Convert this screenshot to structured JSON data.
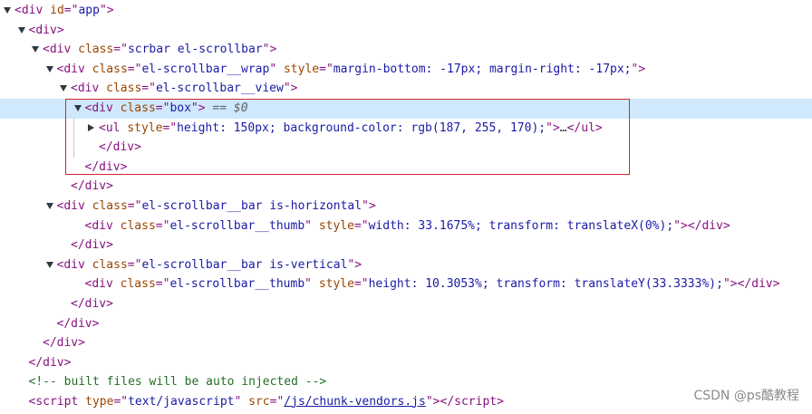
{
  "colors": {
    "tag": "#881280",
    "attr_name": "#994500",
    "attr_value": "#1a1aa6",
    "comment": "#236e25",
    "selected_row": "#cfe8fc",
    "highlight_box": "#d6232f"
  },
  "selection_marker": "== $0",
  "ellipsis": "…",
  "rows": [
    {
      "depth": 0,
      "arrow": "expanded",
      "kind": "open",
      "tag": "div",
      "attrs": [
        [
          "id",
          "app"
        ]
      ]
    },
    {
      "depth": 1,
      "arrow": "expanded",
      "kind": "open",
      "tag": "div",
      "attrs": []
    },
    {
      "depth": 2,
      "arrow": "expanded",
      "kind": "open",
      "tag": "div",
      "attrs": [
        [
          "class",
          "scrbar el-scrollbar"
        ]
      ]
    },
    {
      "depth": 3,
      "arrow": "expanded",
      "kind": "open",
      "tag": "div",
      "attrs": [
        [
          "class",
          "el-scrollbar__wrap"
        ],
        [
          "style",
          "margin-bottom: -17px; margin-right: -17px;"
        ]
      ]
    },
    {
      "depth": 4,
      "arrow": "expanded",
      "kind": "open",
      "tag": "div",
      "attrs": [
        [
          "class",
          "el-scrollbar__view"
        ]
      ]
    },
    {
      "depth": 5,
      "arrow": "expanded",
      "kind": "open",
      "tag": "div",
      "attrs": [
        [
          "class",
          "box"
        ]
      ],
      "selected": true
    },
    {
      "depth": 6,
      "arrow": "collapsed",
      "kind": "collapsed",
      "tag": "ul",
      "attrs": [
        [
          "style",
          "height: 150px; background-color: rgb(187, 255, 170);"
        ]
      ]
    },
    {
      "depth": 6,
      "arrow": "none",
      "kind": "close",
      "tag": "div"
    },
    {
      "depth": 5,
      "arrow": "none",
      "kind": "close",
      "tag": "div"
    },
    {
      "depth": 4,
      "arrow": "none",
      "kind": "close",
      "tag": "div"
    },
    {
      "depth": 3,
      "arrow": "expanded",
      "kind": "open",
      "tag": "div",
      "attrs": [
        [
          "class",
          "el-scrollbar__bar is-horizontal"
        ]
      ]
    },
    {
      "depth": 5,
      "arrow": "none",
      "kind": "leaf",
      "tag": "div",
      "attrs": [
        [
          "class",
          "el-scrollbar__thumb"
        ],
        [
          "style",
          "width: 33.1675%; transform: translateX(0%);"
        ]
      ]
    },
    {
      "depth": 4,
      "arrow": "none",
      "kind": "close",
      "tag": "div"
    },
    {
      "depth": 3,
      "arrow": "expanded",
      "kind": "open",
      "tag": "div",
      "attrs": [
        [
          "class",
          "el-scrollbar__bar is-vertical"
        ]
      ]
    },
    {
      "depth": 5,
      "arrow": "none",
      "kind": "leaf",
      "tag": "div",
      "attrs": [
        [
          "class",
          "el-scrollbar__thumb"
        ],
        [
          "style",
          "height: 10.3053%; transform: translateY(33.3333%);"
        ]
      ]
    },
    {
      "depth": 4,
      "arrow": "none",
      "kind": "close",
      "tag": "div"
    },
    {
      "depth": 3,
      "arrow": "none",
      "kind": "close",
      "tag": "div"
    },
    {
      "depth": 2,
      "arrow": "none",
      "kind": "close",
      "tag": "div"
    },
    {
      "depth": 1,
      "arrow": "none",
      "kind": "close",
      "tag": "div"
    },
    {
      "depth": 1,
      "arrow": "none",
      "kind": "comment",
      "text": "<!-- built files will be auto injected -->"
    },
    {
      "depth": 1,
      "arrow": "none",
      "kind": "script",
      "tag": "script",
      "attrs": [
        [
          "type",
          "text/javascript"
        ]
      ],
      "src_attr": "src",
      "src_value": "/js/chunk-vendors.js"
    }
  ],
  "watermark": "CSDN @ps酷教程"
}
